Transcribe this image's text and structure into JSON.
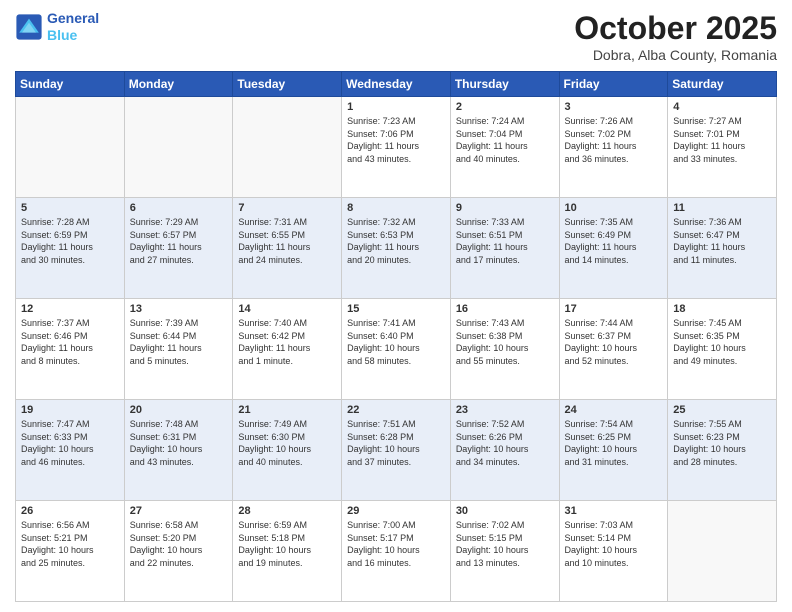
{
  "header": {
    "logo_line1": "General",
    "logo_line2": "Blue",
    "month_title": "October 2025",
    "subtitle": "Dobra, Alba County, Romania"
  },
  "weekdays": [
    "Sunday",
    "Monday",
    "Tuesday",
    "Wednesday",
    "Thursday",
    "Friday",
    "Saturday"
  ],
  "weeks": [
    [
      {
        "day": "",
        "info": ""
      },
      {
        "day": "",
        "info": ""
      },
      {
        "day": "",
        "info": ""
      },
      {
        "day": "1",
        "info": "Sunrise: 7:23 AM\nSunset: 7:06 PM\nDaylight: 11 hours\nand 43 minutes."
      },
      {
        "day": "2",
        "info": "Sunrise: 7:24 AM\nSunset: 7:04 PM\nDaylight: 11 hours\nand 40 minutes."
      },
      {
        "day": "3",
        "info": "Sunrise: 7:26 AM\nSunset: 7:02 PM\nDaylight: 11 hours\nand 36 minutes."
      },
      {
        "day": "4",
        "info": "Sunrise: 7:27 AM\nSunset: 7:01 PM\nDaylight: 11 hours\nand 33 minutes."
      }
    ],
    [
      {
        "day": "5",
        "info": "Sunrise: 7:28 AM\nSunset: 6:59 PM\nDaylight: 11 hours\nand 30 minutes."
      },
      {
        "day": "6",
        "info": "Sunrise: 7:29 AM\nSunset: 6:57 PM\nDaylight: 11 hours\nand 27 minutes."
      },
      {
        "day": "7",
        "info": "Sunrise: 7:31 AM\nSunset: 6:55 PM\nDaylight: 11 hours\nand 24 minutes."
      },
      {
        "day": "8",
        "info": "Sunrise: 7:32 AM\nSunset: 6:53 PM\nDaylight: 11 hours\nand 20 minutes."
      },
      {
        "day": "9",
        "info": "Sunrise: 7:33 AM\nSunset: 6:51 PM\nDaylight: 11 hours\nand 17 minutes."
      },
      {
        "day": "10",
        "info": "Sunrise: 7:35 AM\nSunset: 6:49 PM\nDaylight: 11 hours\nand 14 minutes."
      },
      {
        "day": "11",
        "info": "Sunrise: 7:36 AM\nSunset: 6:47 PM\nDaylight: 11 hours\nand 11 minutes."
      }
    ],
    [
      {
        "day": "12",
        "info": "Sunrise: 7:37 AM\nSunset: 6:46 PM\nDaylight: 11 hours\nand 8 minutes."
      },
      {
        "day": "13",
        "info": "Sunrise: 7:39 AM\nSunset: 6:44 PM\nDaylight: 11 hours\nand 5 minutes."
      },
      {
        "day": "14",
        "info": "Sunrise: 7:40 AM\nSunset: 6:42 PM\nDaylight: 11 hours\nand 1 minute."
      },
      {
        "day": "15",
        "info": "Sunrise: 7:41 AM\nSunset: 6:40 PM\nDaylight: 10 hours\nand 58 minutes."
      },
      {
        "day": "16",
        "info": "Sunrise: 7:43 AM\nSunset: 6:38 PM\nDaylight: 10 hours\nand 55 minutes."
      },
      {
        "day": "17",
        "info": "Sunrise: 7:44 AM\nSunset: 6:37 PM\nDaylight: 10 hours\nand 52 minutes."
      },
      {
        "day": "18",
        "info": "Sunrise: 7:45 AM\nSunset: 6:35 PM\nDaylight: 10 hours\nand 49 minutes."
      }
    ],
    [
      {
        "day": "19",
        "info": "Sunrise: 7:47 AM\nSunset: 6:33 PM\nDaylight: 10 hours\nand 46 minutes."
      },
      {
        "day": "20",
        "info": "Sunrise: 7:48 AM\nSunset: 6:31 PM\nDaylight: 10 hours\nand 43 minutes."
      },
      {
        "day": "21",
        "info": "Sunrise: 7:49 AM\nSunset: 6:30 PM\nDaylight: 10 hours\nand 40 minutes."
      },
      {
        "day": "22",
        "info": "Sunrise: 7:51 AM\nSunset: 6:28 PM\nDaylight: 10 hours\nand 37 minutes."
      },
      {
        "day": "23",
        "info": "Sunrise: 7:52 AM\nSunset: 6:26 PM\nDaylight: 10 hours\nand 34 minutes."
      },
      {
        "day": "24",
        "info": "Sunrise: 7:54 AM\nSunset: 6:25 PM\nDaylight: 10 hours\nand 31 minutes."
      },
      {
        "day": "25",
        "info": "Sunrise: 7:55 AM\nSunset: 6:23 PM\nDaylight: 10 hours\nand 28 minutes."
      }
    ],
    [
      {
        "day": "26",
        "info": "Sunrise: 6:56 AM\nSunset: 5:21 PM\nDaylight: 10 hours\nand 25 minutes."
      },
      {
        "day": "27",
        "info": "Sunrise: 6:58 AM\nSunset: 5:20 PM\nDaylight: 10 hours\nand 22 minutes."
      },
      {
        "day": "28",
        "info": "Sunrise: 6:59 AM\nSunset: 5:18 PM\nDaylight: 10 hours\nand 19 minutes."
      },
      {
        "day": "29",
        "info": "Sunrise: 7:00 AM\nSunset: 5:17 PM\nDaylight: 10 hours\nand 16 minutes."
      },
      {
        "day": "30",
        "info": "Sunrise: 7:02 AM\nSunset: 5:15 PM\nDaylight: 10 hours\nand 13 minutes."
      },
      {
        "day": "31",
        "info": "Sunrise: 7:03 AM\nSunset: 5:14 PM\nDaylight: 10 hours\nand 10 minutes."
      },
      {
        "day": "",
        "info": ""
      }
    ]
  ]
}
